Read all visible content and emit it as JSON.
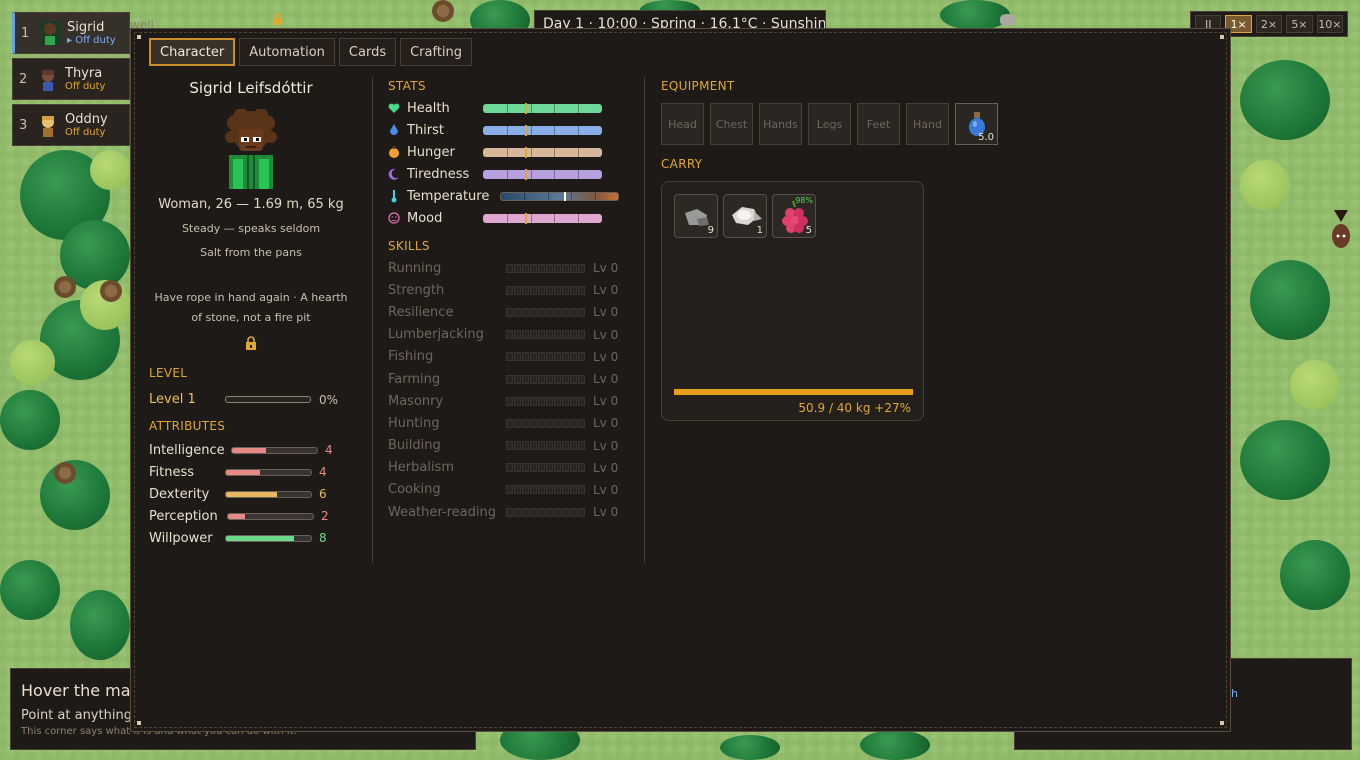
{
  "colonists": [
    {
      "num": "1",
      "name": "Sigrid",
      "status": "▸ Off duty",
      "active": true
    },
    {
      "num": "2",
      "name": "Thyra",
      "status": "Off duty",
      "active": false
    },
    {
      "num": "3",
      "name": "Oddny",
      "status": "Off duty",
      "active": false
    }
  ],
  "behind_label": "well",
  "topbar": {
    "text": "Day 1 · 10:00 · Spring · 16.1°C · Sunshine"
  },
  "speed": {
    "buttons": [
      "II",
      "1×",
      "2×",
      "5×",
      "10×"
    ],
    "selected": "1×"
  },
  "hover_panel": {
    "title": "Hover the ma",
    "subtitle": "Point at anything",
    "hint": "This corner says what it is and what you can do with it."
  },
  "right_panel": {
    "link_text": "h"
  },
  "modal": {
    "tabs": [
      "Character",
      "Automation",
      "Cards",
      "Crafting"
    ],
    "active_tab": "Character",
    "character": {
      "name": "Sigrid Leifsdóttir",
      "bio": "Woman, 26 — 1.69 m, 65 kg",
      "trait1": "Steady — speaks seldom",
      "trait2": "Salt from the pans",
      "wants": "Have rope in hand again · A hearth of stone, not a fire pit"
    },
    "level": {
      "heading": "LEVEL",
      "label": "Level 1",
      "progress_pct": "0%",
      "progress": 0
    },
    "attributes": {
      "heading": "ATTRIBUTES",
      "items": [
        {
          "name": "Intelligence",
          "value": "4",
          "fraction": 0.4,
          "color": "#e58a84"
        },
        {
          "name": "Fitness",
          "value": "4",
          "fraction": 0.4,
          "color": "#e58a84"
        },
        {
          "name": "Dexterity",
          "value": "6",
          "fraction": 0.6,
          "color": "#e8b860"
        },
        {
          "name": "Perception",
          "value": "2",
          "fraction": 0.2,
          "color": "#e58a84"
        },
        {
          "name": "Willpower",
          "value": "8",
          "fraction": 0.8,
          "color": "#6ed88a"
        }
      ]
    },
    "stats": {
      "heading": "STATS",
      "items": [
        {
          "name": "Health",
          "icon": "heart-icon",
          "color": "#6ed89a",
          "marker": 0.35
        },
        {
          "name": "Thirst",
          "icon": "drop-icon",
          "color": "#8aaee8",
          "marker": 0.35
        },
        {
          "name": "Hunger",
          "icon": "food-icon",
          "color": "#d8b89a",
          "marker": 0.35
        },
        {
          "name": "Tiredness",
          "icon": "moon-icon",
          "color": "#b8a0e0",
          "marker": 0.35
        },
        {
          "name": "Temperature",
          "icon": "thermometer-icon",
          "color": "gradient",
          "marker": 0.54
        },
        {
          "name": "Mood",
          "icon": "face-icon",
          "color": "#e0a8d0",
          "marker": 0.35
        }
      ]
    },
    "skills": {
      "heading": "SKILLS",
      "items": [
        {
          "name": "Running",
          "level": "Lv 0"
        },
        {
          "name": "Strength",
          "level": "Lv 0"
        },
        {
          "name": "Resilience",
          "level": "Lv 0"
        },
        {
          "name": "Lumberjacking",
          "level": "Lv 0"
        },
        {
          "name": "Fishing",
          "level": "Lv 0"
        },
        {
          "name": "Farming",
          "level": "Lv 0"
        },
        {
          "name": "Masonry",
          "level": "Lv 0"
        },
        {
          "name": "Hunting",
          "level": "Lv 0"
        },
        {
          "name": "Building",
          "level": "Lv 0"
        },
        {
          "name": "Herbalism",
          "level": "Lv 0"
        },
        {
          "name": "Cooking",
          "level": "Lv 0"
        },
        {
          "name": "Weather-reading",
          "level": "Lv 0"
        }
      ]
    },
    "equipment": {
      "heading": "EQUIPMENT",
      "slots": [
        "Head",
        "Chest",
        "Hands",
        "Legs",
        "Feet",
        "Hand"
      ],
      "filled_slot": {
        "icon": "water-flask-icon",
        "count": "5.0"
      }
    },
    "carry": {
      "heading": "CARRY",
      "items": [
        {
          "icon": "stone-icon",
          "count": "9",
          "pct": ""
        },
        {
          "icon": "flint-icon",
          "count": "1",
          "pct": ""
        },
        {
          "icon": "berries-icon",
          "count": "5",
          "pct": "98%"
        }
      ],
      "weight_text": "50.9 / 40 kg  +27%"
    }
  }
}
